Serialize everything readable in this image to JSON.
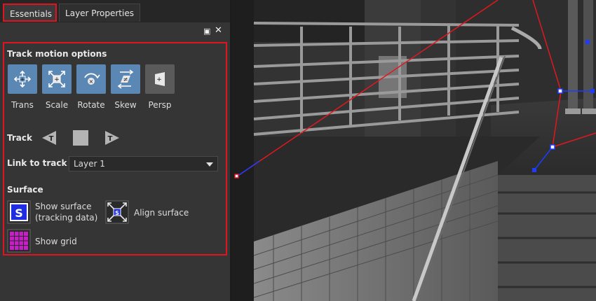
{
  "tabs": [
    {
      "label": "Essentials",
      "active": true
    },
    {
      "label": "Layer Properties",
      "active": false
    }
  ],
  "panel": {
    "float_icon": "float-window-icon",
    "close_icon": "close-icon",
    "motion": {
      "title": "Track motion options",
      "tools": [
        {
          "label": "Trans",
          "icon": "translate-icon",
          "active": true
        },
        {
          "label": "Scale",
          "icon": "scale-icon",
          "active": true
        },
        {
          "label": "Rotate",
          "icon": "rotate-icon",
          "active": true
        },
        {
          "label": "Skew",
          "icon": "skew-icon",
          "active": true
        },
        {
          "label": "Persp",
          "icon": "perspective-icon",
          "active": false
        }
      ]
    },
    "track": {
      "title": "Track",
      "buttons": [
        "track-backward-icon",
        "stop-icon",
        "track-forward-icon"
      ]
    },
    "link": {
      "title": "Link to track",
      "value": "Layer 1"
    },
    "surface": {
      "title": "Surface",
      "show_surface_line1": "Show surface",
      "show_surface_line2": "(tracking data)",
      "align_surface": "Align surface",
      "show_grid": "Show grid"
    }
  },
  "colors": {
    "accent_red": "#e0141e",
    "tool_blue": "#5b87b5",
    "grid_magenta": "#c81ec8",
    "surface_blue": "#1e2ee0"
  }
}
